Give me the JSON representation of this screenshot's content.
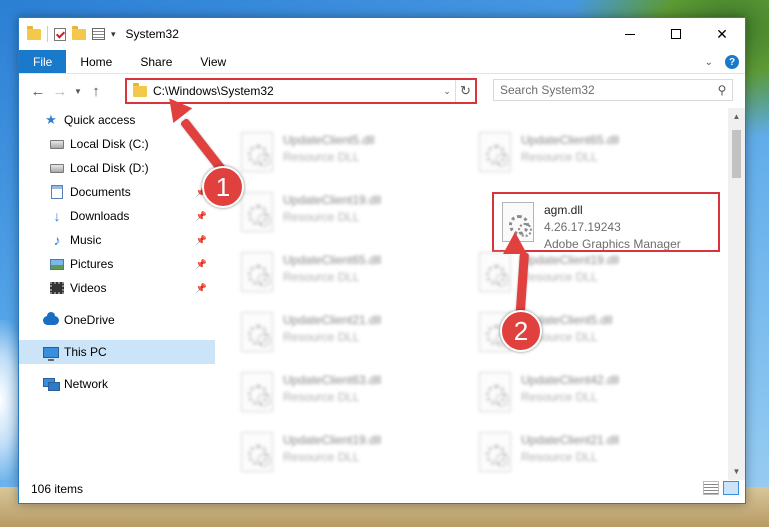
{
  "window": {
    "title": "System32"
  },
  "ribbon": {
    "tabs": [
      "File",
      "Home",
      "Share",
      "View"
    ],
    "help": "?"
  },
  "address": {
    "path": "C:\\Windows\\System32"
  },
  "search": {
    "placeholder": "Search System32"
  },
  "nav": {
    "items": [
      {
        "label": "Quick access",
        "icon": "star-icon"
      },
      {
        "label": "Local Disk (C:)",
        "icon": "disk-icon"
      },
      {
        "label": "Local Disk (D:)",
        "icon": "disk-icon"
      },
      {
        "label": "Documents",
        "icon": "documents-icon"
      },
      {
        "label": "Downloads",
        "icon": "download-icon"
      },
      {
        "label": "Music",
        "icon": "music-icon"
      },
      {
        "label": "Pictures",
        "icon": "pictures-icon"
      },
      {
        "label": "Videos",
        "icon": "videos-icon"
      },
      {
        "label": "OneDrive",
        "icon": "cloud-icon"
      },
      {
        "label": "This PC",
        "icon": "computer-icon"
      },
      {
        "label": "Network",
        "icon": "network-icon"
      }
    ]
  },
  "files": {
    "left": [
      {
        "name": "UpdateClient5.dll",
        "type": "Resource DLL"
      },
      {
        "name": "UpdateClient19.dll",
        "type": "Resource DLL"
      },
      {
        "name": "UpdateClient65.dll",
        "type": "Resource DLL"
      },
      {
        "name": "UpdateClient21.dll",
        "type": "Resource DLL"
      },
      {
        "name": "UpdateClient63.dll",
        "type": "Resource DLL"
      },
      {
        "name": "UpdateClient19.dll",
        "type": "Resource DLL"
      }
    ],
    "right": [
      {
        "name": "UpdateClient65.dll",
        "type": "Resource DLL"
      },
      {
        "name": "UpdateClient19.dll",
        "type": "Resource DLL"
      },
      {
        "name": "UpdateClient5.dll",
        "type": "Resource DLL"
      },
      {
        "name": "UpdateClient42.dll",
        "type": "Resource DLL"
      },
      {
        "name": "UpdateClient21.dll",
        "type": "Resource DLL"
      }
    ],
    "highlighted": {
      "name": "agm.dll",
      "version": "4.26.17.19243",
      "description": "Adobe Graphics Manager"
    }
  },
  "status": {
    "item_count": "106 items"
  },
  "callouts": {
    "one": "1",
    "two": "2"
  },
  "colors": {
    "accent": "#1979ca",
    "annotation": "#e0413e",
    "selection": "#cce4f7"
  }
}
